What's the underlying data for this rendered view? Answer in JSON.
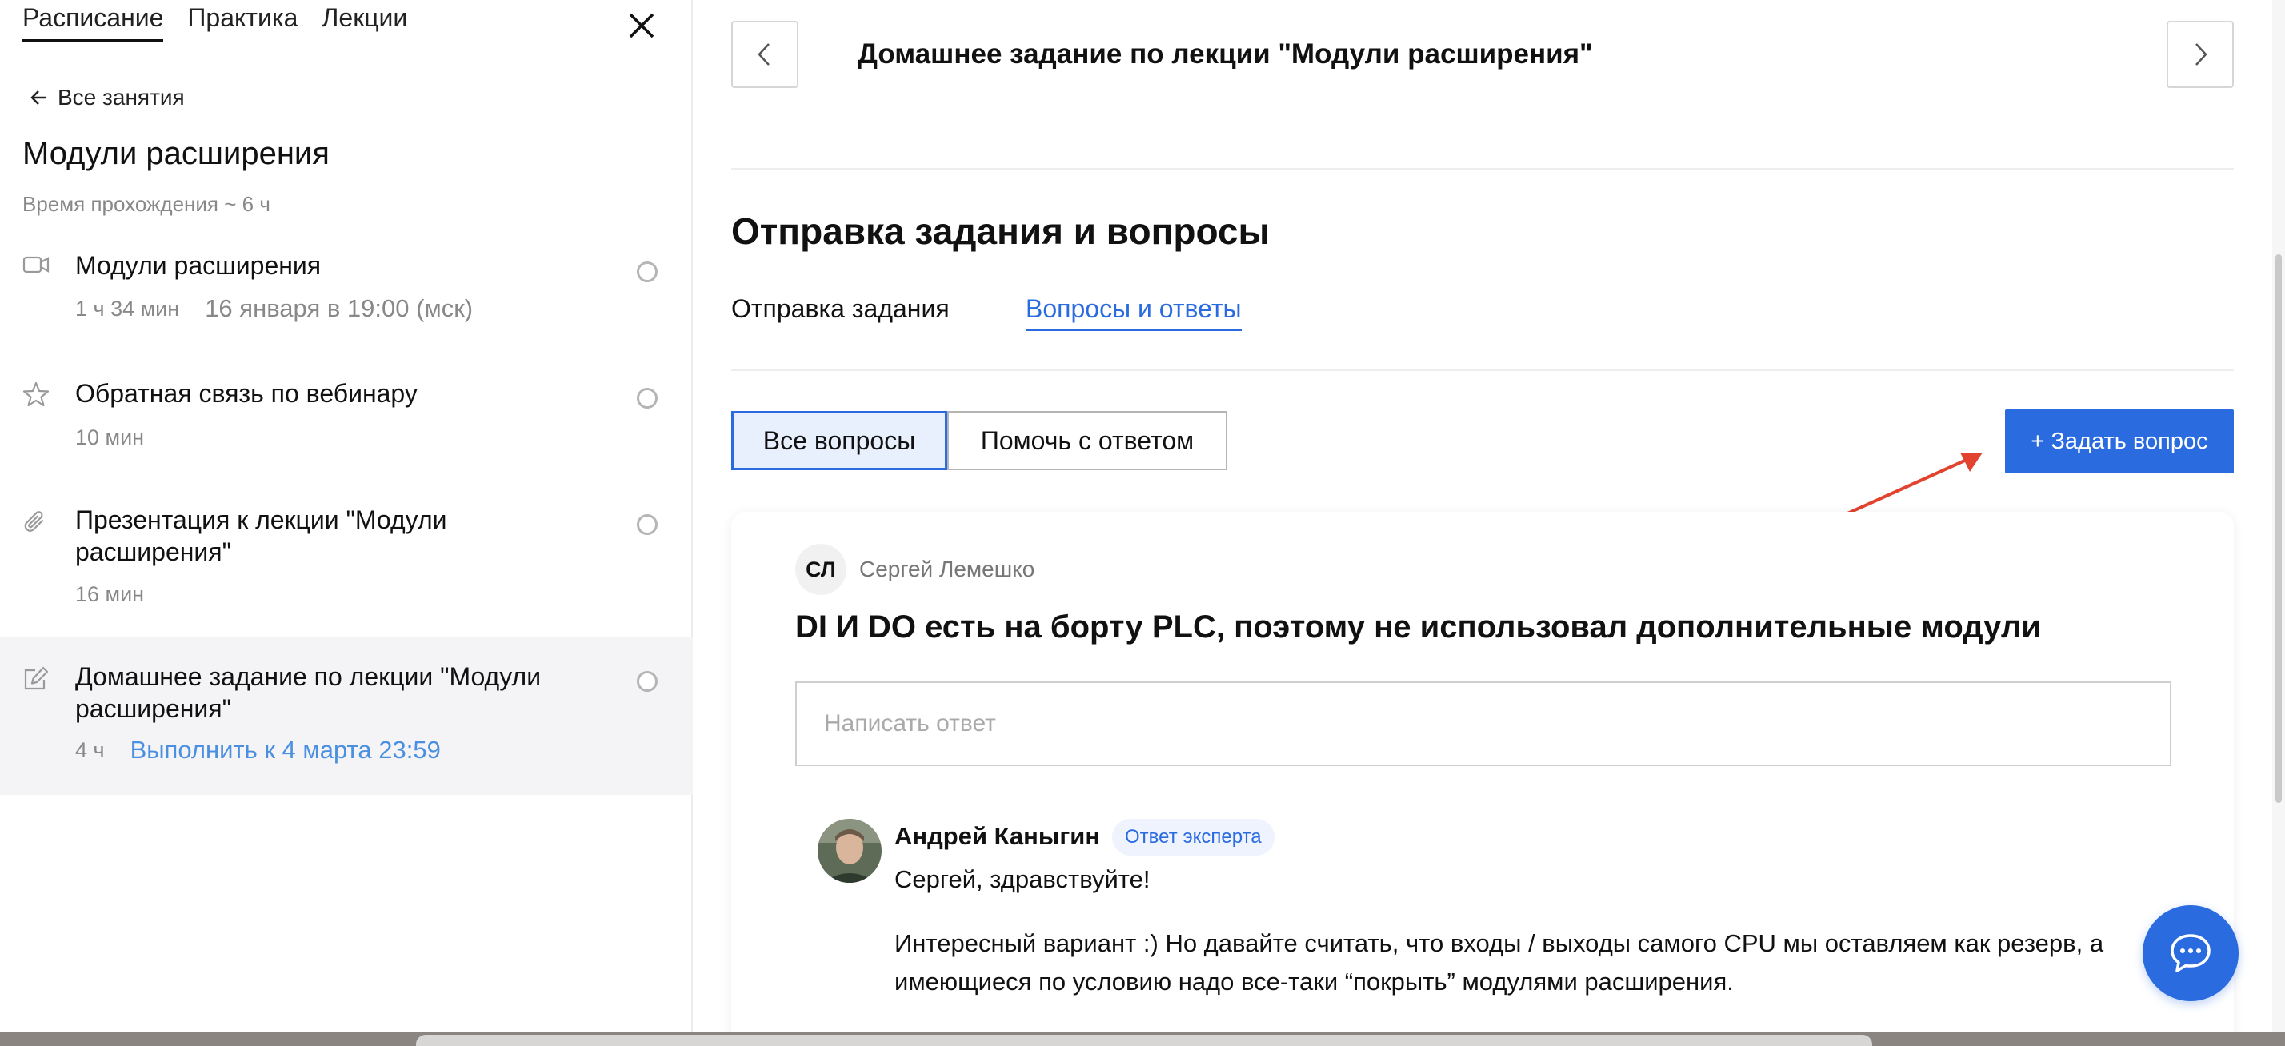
{
  "sidebar": {
    "tabs": [
      {
        "label": "Расписание",
        "active": true
      },
      {
        "label": "Практика",
        "active": false
      },
      {
        "label": "Лекции",
        "active": false
      }
    ],
    "back_label": "Все занятия",
    "title": "Модули расширения",
    "subtitle": "Время прохождения ~ 6 ч",
    "lessons": [
      {
        "icon": "video-camera-icon",
        "title": "Модули расширения",
        "duration": "1 ч 34 мин",
        "date": "16 января в 19:00 (мск)"
      },
      {
        "icon": "star-icon",
        "title": "Обратная связь по вебинару",
        "duration": "10 мин"
      },
      {
        "icon": "paperclip-icon",
        "title": "Презентация к лекции \"Модули расширения\"",
        "duration": "16 мин"
      },
      {
        "icon": "edit-icon",
        "title": "Домашнее задание по лекции \"Модули расширения\"",
        "duration": "4 ч",
        "deadline": "Выполнить к 4 марта 23:59",
        "active": true
      }
    ]
  },
  "main": {
    "homework_title": "Домашнее задание по лекции \"Модули расширения\"",
    "section_title": "Отправка задания и вопросы",
    "tabs": [
      {
        "label": "Отправка задания",
        "active": false
      },
      {
        "label": "Вопросы и ответы",
        "active": true
      }
    ],
    "filters": [
      {
        "label": "Все вопросы",
        "active": true
      },
      {
        "label": "Помочь с ответом",
        "active": false
      }
    ],
    "ask_button": "+ Задать вопрос",
    "question": {
      "author_initials": "СЛ",
      "author": "Сергей Лемешко",
      "text": "DI И DO есть на борту PLC, поэтому не использовал дополнительные модули",
      "reply_placeholder": "Написать ответ"
    },
    "answer": {
      "author": "Андрей Каныгин",
      "badge": "Ответ эксперта",
      "greeting": "Сергей, здравствуйте!",
      "body": "Интересный вариант :) Но давайте считать, что входы / выходы самого CPU мы оставляем как резерв, а имеющиеся по условию надо все-таки “покрыть” модулями расширения."
    }
  },
  "colors": {
    "accent": "#2a6be0",
    "deadline": "#4a8fe0",
    "annotation_arrow": "#e2432e"
  }
}
